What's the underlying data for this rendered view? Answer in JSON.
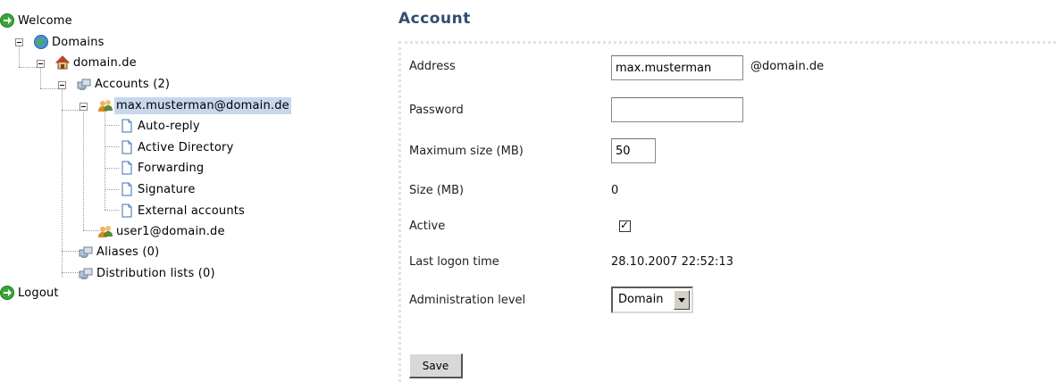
{
  "tree": {
    "welcome": "Welcome",
    "domains": "Domains",
    "domain": "domain.de",
    "accounts": "Accounts (2)",
    "account_selected": "max.musterman@domain.de",
    "subitems": [
      "Auto-reply",
      "Active Directory",
      "Forwarding",
      "Signature",
      "External accounts"
    ],
    "account_second": "user1@domain.de",
    "aliases": "Aliases (0)",
    "distribution_lists": "Distribution lists (0)",
    "logout": "Logout"
  },
  "form": {
    "heading": "Account",
    "address_label": "Address",
    "address_value": "max.musterman",
    "domain_suffix": "@domain.de",
    "password_label": "Password",
    "password_value": "",
    "max_size_label": "Maximum size (MB)",
    "max_size_value": "50",
    "size_label": "Size (MB)",
    "size_value": "0",
    "active_label": "Active",
    "active_checked": true,
    "last_logon_label": "Last logon time",
    "last_logon_value": "28.10.2007 22:52:13",
    "admin_level_label": "Administration level",
    "admin_level_value": "Domain",
    "save_label": "Save"
  },
  "colors": {
    "heading": "#304d6e",
    "selection": "#c6d7ee",
    "green_icon": "#3aa53a"
  },
  "icons": {
    "welcome": "green-arrow-icon",
    "domains": "globe-icon",
    "domain": "house-icon",
    "accounts": "computer-group-icon",
    "account": "users-icon",
    "subitem": "document-icon",
    "logout": "green-arrow-icon"
  }
}
